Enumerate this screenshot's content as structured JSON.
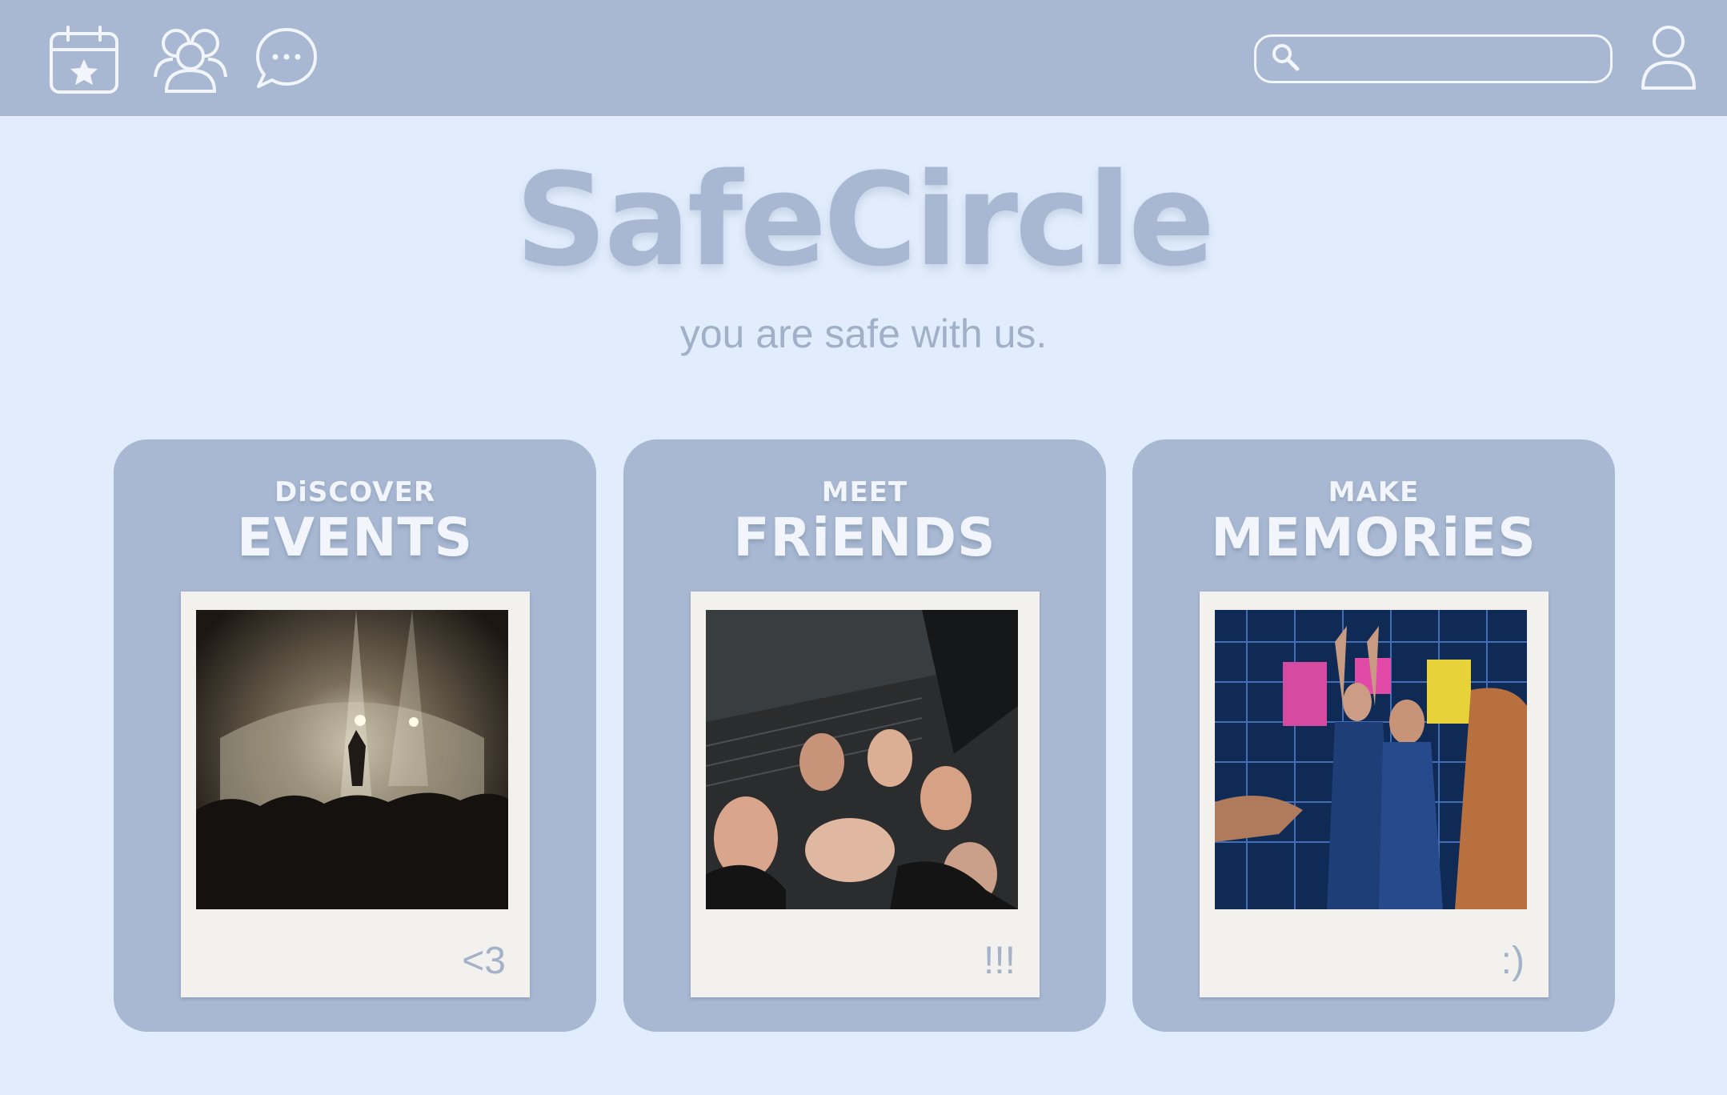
{
  "header": {
    "search": {
      "placeholder": "",
      "value": ""
    },
    "icons": [
      "calendar-star-icon",
      "friends-icon",
      "chat-bubble-icon",
      "search-icon",
      "profile-icon"
    ]
  },
  "hero": {
    "logo": "SafeCircle",
    "tagline": "you are safe with us."
  },
  "cards": [
    {
      "top": "DiSCOVER",
      "title": "EVENTS",
      "caption": "<3",
      "photo": "concert crowd photo"
    },
    {
      "top": "MEET",
      "title": "FRiENDS",
      "caption": "!!!",
      "photo": "group of friends photo"
    },
    {
      "top": "MAKE",
      "title": "MEMORiES",
      "caption": ":)",
      "photo": "friends posing photo"
    }
  ],
  "colors": {
    "background": "#e1edfc",
    "bar": "#a8b8d2",
    "icon": "#f2f6fc",
    "polaroid": "#f3f1ed"
  }
}
